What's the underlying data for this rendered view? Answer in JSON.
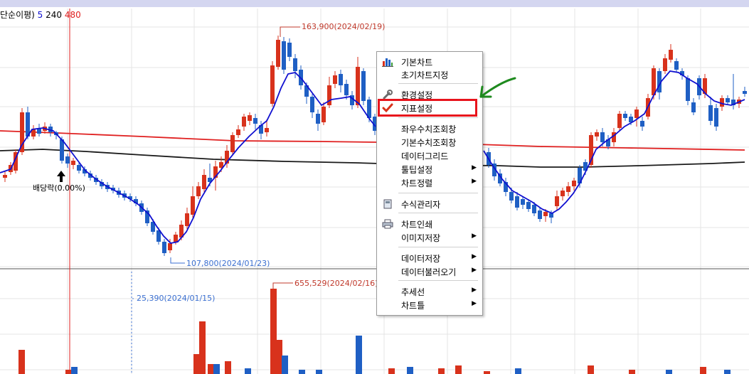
{
  "legend": {
    "prefix": "단순이평)",
    "ma_short": "5",
    "ma_mid": "240",
    "ma_long": "480"
  },
  "annotations": {
    "price_high": "163,900(2024/02/19)",
    "price_low": "107,800(2024/01/23)",
    "dividend": "배당락(0.00%)",
    "volume_high": "655,529(2024/02/16)",
    "volume_low": "25,390(2024/01/15)"
  },
  "colors": {
    "up": "#d8321c",
    "down": "#1f5fc4",
    "ma_short": "#1010d0",
    "ma_mid": "#1a1a1a",
    "ma_long": "#e02020",
    "highlight": "#e8141c",
    "pointer_arrow": "#1e8a1e"
  },
  "context_menu": {
    "items": [
      {
        "label": "기본차트",
        "icon": "bar-chart-icon"
      },
      {
        "label": "초기차트지정"
      },
      {
        "label": "환경설정",
        "icon": "wrench-icon"
      },
      {
        "label": "지표설정",
        "icon": "checkmark-icon",
        "highlighted": true
      },
      {
        "label": "좌우수치조회창"
      },
      {
        "label": "기본수치조회창"
      },
      {
        "label": "데이터그리드"
      },
      {
        "label": "툴팁설정",
        "submenu": true
      },
      {
        "label": "차트정렬",
        "submenu": true
      },
      {
        "label": "수식관리자",
        "icon": "calculator-icon"
      },
      {
        "label": "차트인쇄",
        "icon": "printer-icon"
      },
      {
        "label": "이미지저장",
        "submenu": true
      },
      {
        "label": "데이터저장",
        "submenu": true
      },
      {
        "label": "데이터불러오기",
        "submenu": true
      },
      {
        "label": "추세선",
        "submenu": true
      },
      {
        "label": "차트틀",
        "submenu": true
      }
    ],
    "submenu_arrow": "▶"
  },
  "chart_data": {
    "type": "candlestick",
    "price_panel": {
      "annotated_high": {
        "value": 163900,
        "date": "2024/02/19"
      },
      "annotated_low": {
        "value": 107800,
        "date": "2024/01/23"
      }
    },
    "volume_panel": {
      "annotated_high": {
        "value": 655529,
        "date": "2024/02/16"
      },
      "annotated_low": {
        "value": 25390,
        "date": "2024/01/15"
      }
    },
    "moving_averages": [
      {
        "name": "5",
        "color": "#1010d0"
      },
      {
        "name": "240",
        "color": "#1a1a1a"
      },
      {
        "name": "480",
        "color": "#e02020"
      }
    ]
  }
}
